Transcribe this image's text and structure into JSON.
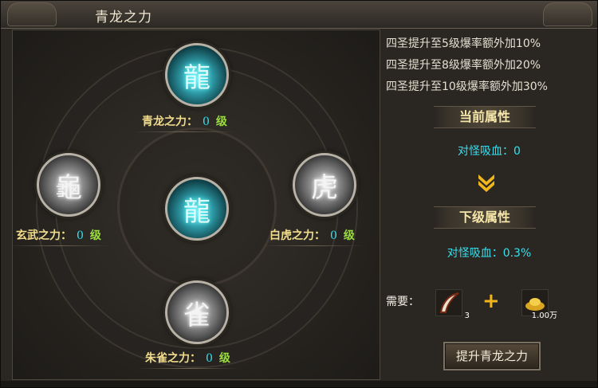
{
  "window": {
    "title": "青龙之力"
  },
  "orbs": {
    "top": {
      "name": "青龙之力：",
      "level": "0",
      "suffix": "级",
      "icon": "dragon-orb-icon"
    },
    "left": {
      "name": "玄武之力：",
      "level": "0",
      "suffix": "级",
      "icon": "tortoise-orb-icon"
    },
    "right": {
      "name": "白虎之力：",
      "level": "0",
      "suffix": "级",
      "icon": "tiger-orb-icon"
    },
    "bottom": {
      "name": "朱雀之力：",
      "level": "0",
      "suffix": "级",
      "icon": "phoenix-orb-icon"
    },
    "center": {
      "icon": "dragon-center-icon"
    }
  },
  "bonuses": [
    "四圣提升至5级爆率额外加10%",
    "四圣提升至8级爆率额外加20%",
    "四圣提升至10级爆率额外加30%"
  ],
  "current": {
    "header": "当前属性",
    "stat": "对怪吸血：0"
  },
  "next": {
    "header": "下级属性",
    "stat": "对怪吸血：0.3%"
  },
  "requirements": {
    "label": "需要：",
    "item_count": "3",
    "gold_amount": "1.00万",
    "item_icon": "claw-item-icon",
    "gold_icon": "gold-ingot-icon"
  },
  "upgrade_button": "提升青龙之力",
  "colors": {
    "accent": "#36e1f1",
    "gold": "#f0dc8c",
    "green": "#9bdd3f",
    "arrow": "#f2b61d"
  }
}
